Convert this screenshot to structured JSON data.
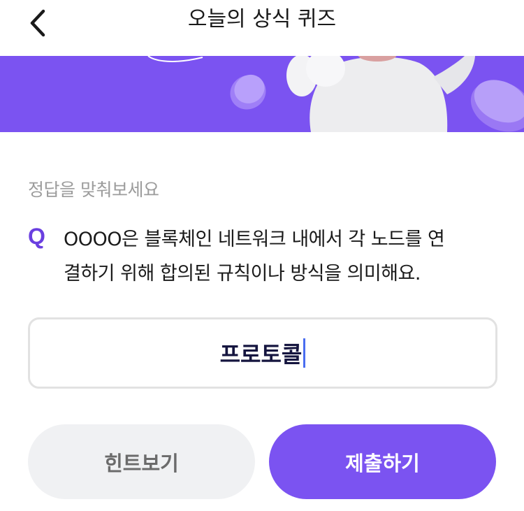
{
  "header": {
    "title": "오늘의 상식 퀴즈",
    "back_icon": "chevron-left-icon"
  },
  "banner": {
    "background_color": "#7b53f1",
    "illustration": "mascot-with-coins"
  },
  "quiz": {
    "prompt": "정답을 맞춰보세요",
    "question_marker": "Q",
    "question_line1": "OOOO은 블록체인 네트워크 내에서 각 노드를 연",
    "question_line2": "결하기 위해 합의된 규칙이나 방식을 의미해요.",
    "answer_value": "프로토콜"
  },
  "buttons": {
    "hint_label": "힌트보기",
    "submit_label": "제출하기"
  },
  "colors": {
    "accent": "#7b53f1",
    "question_marker": "#6a3fe0",
    "hint_bg": "#f0f1f3",
    "caret": "#4a6df0"
  }
}
